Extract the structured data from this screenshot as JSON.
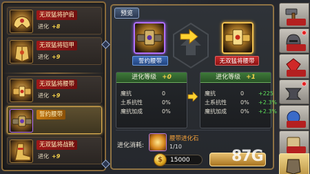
{
  "item_list": [
    {
      "name": "无双猛将护肩",
      "level_label": "进化",
      "bonus": "+8",
      "name_color": "red",
      "selected": false
    },
    {
      "name": "无双猛将铠甲",
      "level_label": "进化",
      "bonus": "+9",
      "name_color": "red",
      "selected": false
    },
    {
      "name": "无双猛将腰带",
      "level_label": "进化",
      "bonus": "+9",
      "name_color": "red",
      "selected": false
    },
    {
      "name": "誓约腰带",
      "level_label": "",
      "bonus": "",
      "name_color": "orange",
      "selected": true
    },
    {
      "name": "无双猛将战靴",
      "level_label": "进化",
      "bonus": "+9",
      "name_color": "red",
      "selected": false
    }
  ],
  "center": {
    "preview_tab": "预览",
    "current_item": "誓约腰带",
    "target_item": "无双猛将腰带",
    "current_stats": {
      "header": "进化等级",
      "level": "+0",
      "rows": [
        {
          "name": "魔抗",
          "value": "0"
        },
        {
          "name": "土系抗性",
          "value": "0%"
        },
        {
          "name": "魔抗加成",
          "value": "0%"
        }
      ]
    },
    "target_stats": {
      "header": "进化等级",
      "level": "+1",
      "rows": [
        {
          "name": "魔抗",
          "value": "0",
          "plus": "+225"
        },
        {
          "name": "土系抗性",
          "value": "0%",
          "plus": "+2.3%"
        },
        {
          "name": "魔抗加成",
          "value": "0%",
          "plus": "+2.3%"
        }
      ]
    },
    "cost_label": "进化消耗:",
    "stone_name": "腰带进化石",
    "stone_count": "1/10",
    "gold": "15000"
  },
  "right_tabs": [
    {
      "name": "tab-1",
      "tag": "",
      "active": false
    },
    {
      "name": "tab-2",
      "tag": "",
      "active": false
    },
    {
      "name": "tab-3",
      "tag": "",
      "active": false
    },
    {
      "name": "tab-4",
      "tag": "",
      "active": false
    },
    {
      "name": "tab-5",
      "tag": "",
      "active": false
    },
    {
      "name": "tab-6",
      "tag": "",
      "active": false
    },
    {
      "name": "tab-7",
      "tag": "",
      "active": true
    }
  ],
  "watermark": "87G",
  "colors": {
    "frame_gold": "#8f7344",
    "name_red": "#a01818",
    "name_orange": "#c87a10",
    "bonus_yellow": "#f6d24a",
    "plus_green": "#5ee05a",
    "stat_header_green": "#3f7a3a"
  }
}
